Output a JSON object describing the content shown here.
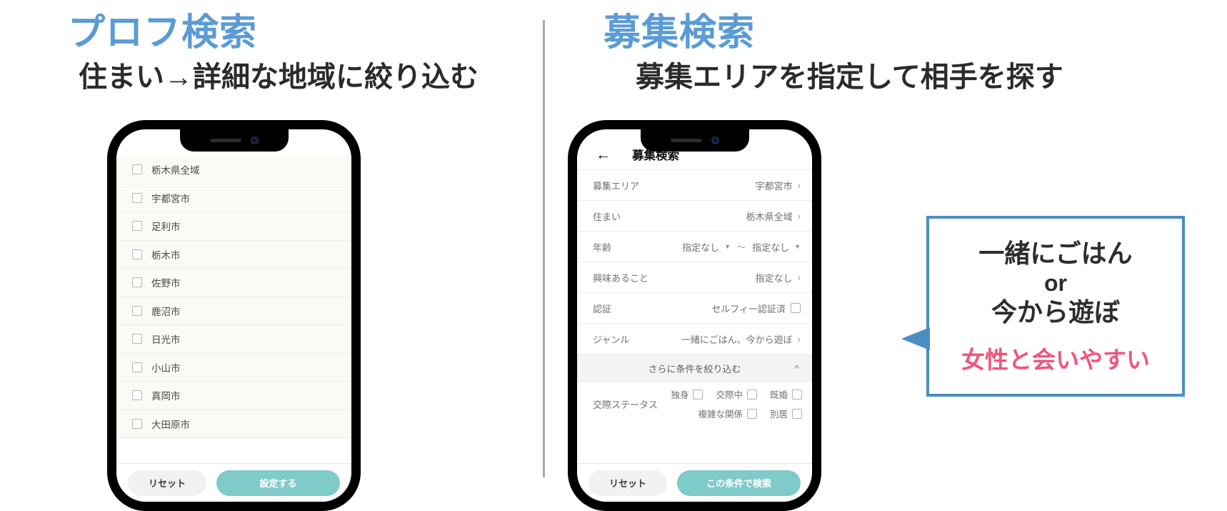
{
  "left_panel": {
    "title": "プロフ検索",
    "subtitle": "住まい→詳細な地域に絞り込む",
    "list_items": [
      "栃木県全域",
      "宇都宮市",
      "足利市",
      "栃木市",
      "佐野市",
      "鹿沼市",
      "日光市",
      "小山市",
      "真岡市",
      "大田原市"
    ],
    "footer": {
      "reset_label": "リセット",
      "primary_label": "設定する"
    }
  },
  "right_panel": {
    "title": "募集検索",
    "subtitle": "募集エリアを指定して相手を探す",
    "app": {
      "header_title": "募集検索",
      "back_icon": "←",
      "rows": [
        {
          "label": "募集エリア",
          "value": "宇都宮市",
          "control": "chevron"
        },
        {
          "label": "住まい",
          "value": "栃木県全域",
          "control": "chevron"
        },
        {
          "label": "年齢",
          "value_min": "指定なし",
          "value_max": "指定なし",
          "separator": "〜",
          "control": "dual-dropdown"
        },
        {
          "label": "興味あること",
          "value": "指定なし",
          "control": "chevron"
        },
        {
          "label": "認証",
          "value": "セルフィー認証済",
          "control": "checkbox"
        },
        {
          "label": "ジャンル",
          "value": "一緒にごはん、今から遊ぼ",
          "control": "chevron"
        }
      ],
      "accordion_label": "さらに条件を絞り込む",
      "status": {
        "label": "交際ステータス",
        "options_row1": [
          "独身",
          "交際中",
          "既婚"
        ],
        "options_row2": [
          "複雑な関係",
          "別居"
        ]
      },
      "footer": {
        "reset_label": "リセット",
        "primary_label": "この条件で検索"
      }
    }
  },
  "callout": {
    "line1": "一緒にごはん",
    "line2": "or",
    "line3": "今から遊ぼ",
    "accent": "女性と会いやすい"
  },
  "colors": {
    "heading_blue": "#5b9bd5",
    "callout_border": "#4a8ec2",
    "accent_pink": "#f2557c",
    "primary_teal": "#7fcbc9"
  }
}
